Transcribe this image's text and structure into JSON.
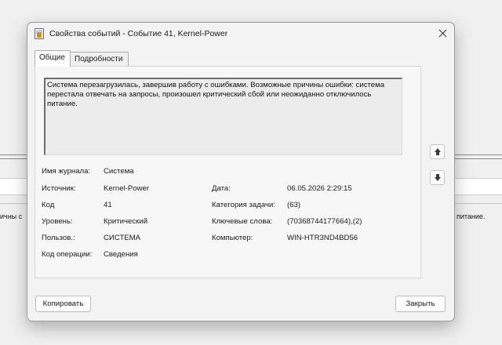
{
  "background": {
    "left_fragment": "ичны с",
    "right_fragment": "питание."
  },
  "dialog": {
    "title": "Свойства событий - Событие 41, Kernel-Power",
    "icons": {
      "app": "event-properties-icon",
      "close": "close-icon",
      "up": "arrow-up-icon",
      "down": "arrow-down-icon"
    },
    "tabs": [
      {
        "label": "Общие",
        "active": true
      },
      {
        "label": "Подробности",
        "active": false
      }
    ],
    "description": "Система перезагрузилась, завершив работу с ошибками. Возможные причины ошибки: система перестала отвечать на запросы, произошел критический сбой или неожиданно отключилось питание.",
    "fields": {
      "log_name": {
        "label": "Имя журнала:",
        "value": "Система"
      },
      "source": {
        "label": "Источник:",
        "value": "Kernel-Power"
      },
      "code": {
        "label": "Код",
        "value": "41"
      },
      "level": {
        "label": "Уровень:",
        "value": "Критический"
      },
      "user": {
        "label": "Пользов.:",
        "value": "СИСТЕМА"
      },
      "opcode": {
        "label": "Код операции:",
        "value": "Сведения"
      },
      "date": {
        "label": "Дата:",
        "value": "06.05.2026 2:29:15"
      },
      "task_category": {
        "label": "Категория задачи:",
        "value": "(63)"
      },
      "keywords": {
        "label": "Ключевые слова:",
        "value": "(70368744177664),(2)"
      },
      "computer": {
        "label": "Компьютер:",
        "value": "WIN-HTR3ND4BD56"
      }
    },
    "buttons": {
      "copy": "Копировать",
      "close": "Закрыть"
    }
  }
}
